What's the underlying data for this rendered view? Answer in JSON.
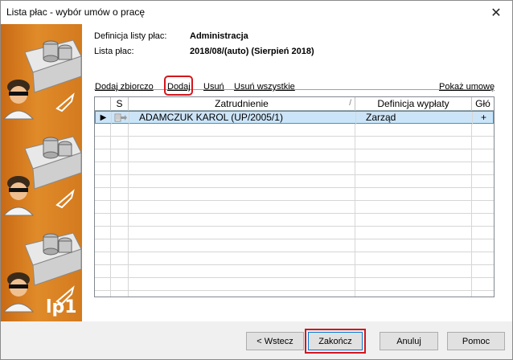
{
  "window": {
    "title": "Lista płac - wybór umów o pracę",
    "close_symbol": "✕"
  },
  "banner": {
    "label": "lp1"
  },
  "info": {
    "definition_label": "Definicja listy płac:",
    "definition_value": "Administracja",
    "payroll_label": "Lista płac:",
    "payroll_value": "2018/08/(auto) (Sierpień 2018)"
  },
  "links": {
    "add_bulk": "Dodaj zbiorczo",
    "add": "Dodaj",
    "remove": "Usuń",
    "remove_all": "Usuń wszystkie",
    "show_contracts": "Pokaż umowę"
  },
  "table": {
    "headers": {
      "s": "S",
      "employment": "Zatrudnienie",
      "sort_indicator": "/",
      "payout_def": "Definicja wypłaty",
      "main": "Głó"
    },
    "rows": [
      {
        "pointer": "▶",
        "s_icon": "contract-arrow-icon",
        "employment": "ADAMCZUK KAROL (UP/2005/1)",
        "payout_def": "Zarząd",
        "main": "+"
      }
    ]
  },
  "buttons": {
    "back": "< Wstecz",
    "finish": "Zakończ",
    "cancel": "Anuluj",
    "help": "Pomoc"
  },
  "colors": {
    "accent": "#d4161c",
    "selection": "#cce4f7",
    "banner": "#d87a1e"
  }
}
